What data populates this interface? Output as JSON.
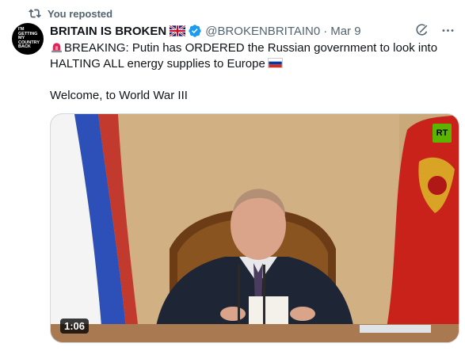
{
  "repost": {
    "label": "You reposted",
    "icon": "repost-icon"
  },
  "author": {
    "avatar_text": "I'M GETTING MY COUNTRY BACK",
    "display_name": "BRITAIN IS BROKEN",
    "handle": "@BROKENBRITAIN0",
    "date": "Mar 9",
    "flag_icon": "uk-flag-icon",
    "verified_icon": "verified-badge-icon",
    "verified_color": "#1d9bf0"
  },
  "actions": {
    "grok_icon": "grok-icon",
    "more_icon": "more-options-icon"
  },
  "tweet": {
    "line1": "BREAKING: Putin has ORDERED the Russian government to look into HALTING ALL energy supplies to Europe",
    "line2": "Welcome, to World War III",
    "siren_icon": "siren-icon",
    "ru_flag_icon": "russia-flag-icon"
  },
  "media": {
    "duration": "1:06",
    "channel_logo": "RT"
  },
  "colors": {
    "secondary_text": "#536471",
    "primary_text": "#0f1419",
    "border": "#cfd9de"
  }
}
